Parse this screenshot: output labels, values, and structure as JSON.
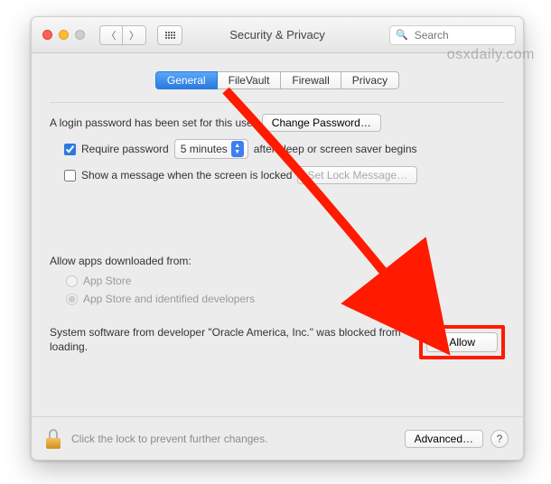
{
  "window": {
    "title": "Security & Privacy",
    "search_placeholder": "Search"
  },
  "tabs": {
    "general": "General",
    "filevault": "FileVault",
    "firewall": "Firewall",
    "privacy": "Privacy"
  },
  "login": {
    "password_set_text": "A login password has been set for this user",
    "change_password_label": "Change Password…",
    "require_password_label": "Require password",
    "require_password_checked": true,
    "delay_value": "5 minutes",
    "after_text": "after sleep or screen saver begins",
    "show_message_label": "Show a message when the screen is locked",
    "show_message_checked": false,
    "set_lock_message_label": "Set Lock Message…"
  },
  "allow_apps": {
    "heading": "Allow apps downloaded from:",
    "option_appstore": "App Store",
    "option_identified": "App Store and identified developers",
    "selected": "identified"
  },
  "blocked": {
    "text": "System software from developer \"Oracle America, Inc.\" was blocked from loading.",
    "allow_label": "Allow"
  },
  "footer": {
    "lock_text": "Click the lock to prevent further changes.",
    "advanced_label": "Advanced…",
    "help_label": "?"
  },
  "watermark": "osxdaily.com"
}
